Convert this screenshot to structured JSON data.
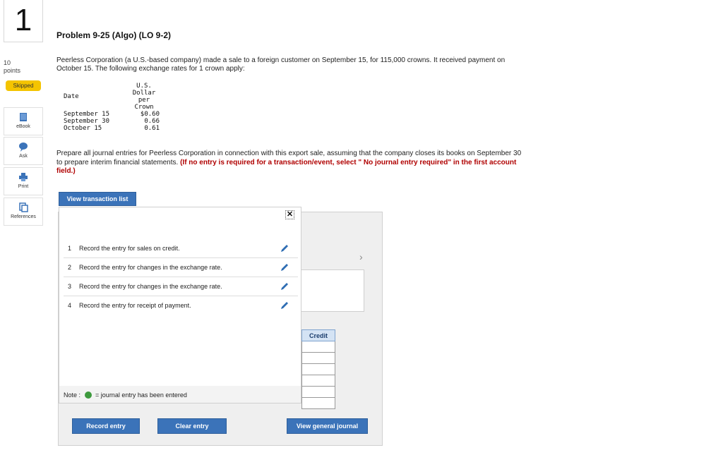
{
  "question": {
    "number": "1",
    "points_value": "10",
    "points_label": "points",
    "status": "Skipped"
  },
  "tools": {
    "ebook": "eBook",
    "ask": "Ask",
    "print": "Print",
    "references": "References"
  },
  "problem": {
    "title": "Problem 9-25 (Algo) (LO 9-2)",
    "intro": "Peerless Corporation (a U.S.-based company) made a sale to a foreign customer on September 15, for 115,000 crowns. It received payment on October 15. The following exchange rates for 1 crown apply:",
    "rates_table": {
      "col1_header": "Date",
      "col2_header_lines": [
        "U.S.",
        "Dollar",
        "per",
        "Crown"
      ],
      "rows": [
        {
          "date": "September 15",
          "rate": "$0.60"
        },
        {
          "date": "September 30",
          "rate": "0.66"
        },
        {
          "date": "October 15",
          "rate": "0.61"
        }
      ]
    },
    "instruction": "Prepare all journal entries for Peerless Corporation in connection with this export sale, assuming that the company closes its books on September 30 to prepare interim financial statements.",
    "instruction_red": "(If no entry is required for a transaction/event, select \" No journal entry required\" in the first account field.)"
  },
  "buttons": {
    "view_transaction_list": "View transaction list",
    "record_entry": "Record entry",
    "clear_entry": "Clear entry",
    "view_general_journal": "View general journal"
  },
  "journal": {
    "credit_header": "Credit"
  },
  "popup": {
    "close_symbol": "✕",
    "transactions": [
      {
        "num": "1",
        "text": "Record the entry for sales on credit."
      },
      {
        "num": "2",
        "text": "Record the entry for changes in the exchange rate."
      },
      {
        "num": "3",
        "text": "Record the entry for changes in the exchange rate."
      },
      {
        "num": "4",
        "text": "Record the entry for receipt of payment."
      }
    ],
    "note_prefix": "Note :",
    "note_suffix": "= journal entry has been entered"
  },
  "colors": {
    "button_blue": "#3b73b9",
    "skipped_badge": "#f4c400",
    "instruction_red": "#b00000",
    "entered_dot": "#3e9a3e"
  }
}
